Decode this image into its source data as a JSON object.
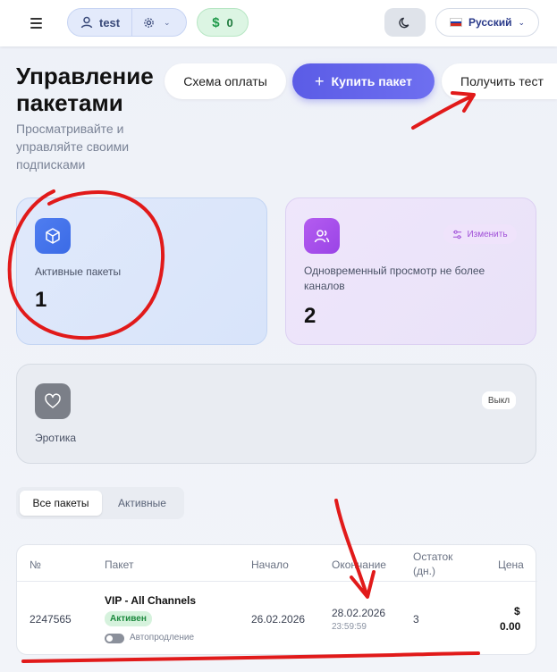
{
  "topbar": {
    "user_name": "test",
    "balance": "0",
    "language": "Русский"
  },
  "header": {
    "title": "Управление пакетами",
    "subtitle": "Просматривайте и управляйте своими подписками",
    "scheme_button": "Схема оплаты",
    "buy_button": "Купить пакет",
    "test_button": "Получить тест"
  },
  "cards": {
    "active": {
      "label": "Активные пакеты",
      "value": "1"
    },
    "streams": {
      "label": "Одновременный просмотр не более каналов",
      "value": "2",
      "change_label": "Изменить"
    },
    "erotica": {
      "label": "Эротика",
      "status": "Выкл"
    }
  },
  "tabs": {
    "all": "Все пакеты",
    "active": "Активные"
  },
  "table": {
    "headers": {
      "number": "№",
      "package": "Пакет",
      "start": "Начало",
      "end": "Окончание",
      "remaining": "Остаток (дн.)",
      "price": "Цена"
    },
    "rows": [
      {
        "number": "2247565",
        "package": "VIP - All Channels",
        "status": "Активен",
        "autorenew_label": "Автопродление",
        "start": "26.02.2026",
        "end_date": "28.02.2026",
        "end_time": "23:59:59",
        "remaining": "3",
        "price_symbol": "$",
        "price_value": "0.00"
      }
    ]
  },
  "colors": {
    "accent": "#5b5ce6",
    "annotation": "#e11a1a"
  }
}
